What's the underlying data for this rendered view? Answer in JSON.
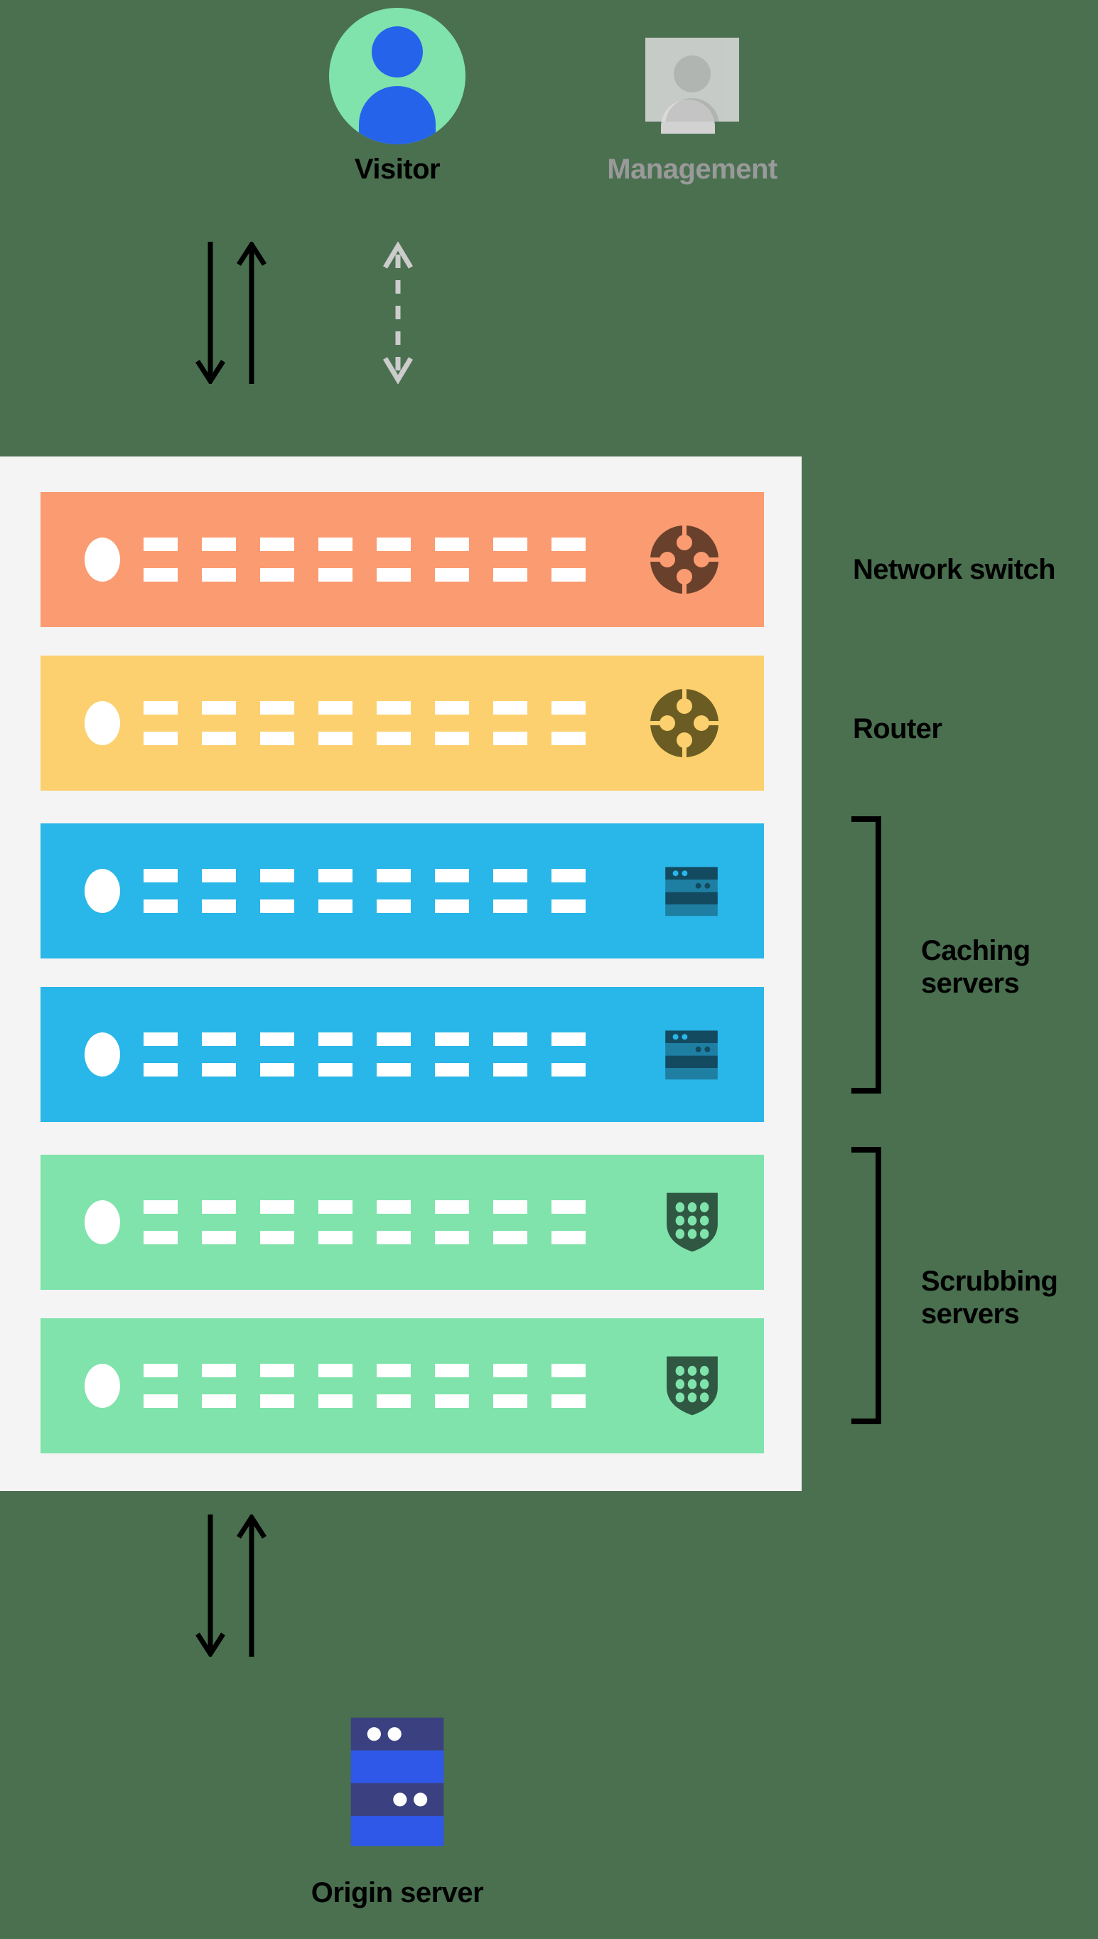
{
  "background_color": "#4a7050",
  "panel_color": "#f4f4f4",
  "actors": {
    "visitor": {
      "label": "Visitor",
      "icon": "person-avatar-icon",
      "label_color": "#000000",
      "circle_color": "#7fe3ab",
      "figure_color": "#2563eb"
    },
    "management": {
      "label": "Management",
      "icon": "management-person-icon",
      "label_color": "#9a9a9a",
      "panel_color": "#dcdcdc",
      "figure_color": "#c2c2c2"
    }
  },
  "connectors": {
    "visitor_top": {
      "name": "visitor-traffic-arrows",
      "style": "solid",
      "color": "#000000",
      "directions": [
        "down",
        "up"
      ]
    },
    "management_top": {
      "name": "management-arrow",
      "style": "dashed",
      "color": "#cccccc",
      "directions": [
        "up",
        "down"
      ]
    },
    "origin_bottom": {
      "name": "origin-traffic-arrows",
      "style": "solid",
      "color": "#000000",
      "directions": [
        "down",
        "up"
      ]
    }
  },
  "rack": {
    "rows": [
      {
        "id": "network-switch",
        "color": "#fb9b71",
        "icon": "network-hub-icon",
        "icon_color": "#68402c",
        "ports_per_row": 8,
        "port_rows": 2
      },
      {
        "id": "router",
        "color": "#fcd06e",
        "icon": "network-hub-icon",
        "icon_color": "#6b5c23",
        "ports_per_row": 8,
        "port_rows": 2
      },
      {
        "id": "caching-server-1",
        "color": "#29b6e8",
        "icon": "server-stack-icon",
        "icon_color": "#134a60",
        "icon_color_alt": "#1e7fa3",
        "ports_per_row": 8,
        "port_rows": 2
      },
      {
        "id": "caching-server-2",
        "color": "#29b6e8",
        "icon": "server-stack-icon",
        "icon_color": "#134a60",
        "icon_color_alt": "#1e7fa3",
        "ports_per_row": 8,
        "port_rows": 2
      },
      {
        "id": "scrubbing-server-1",
        "color": "#7fe3ab",
        "icon": "shield-dots-icon",
        "icon_color": "#2f5742",
        "ports_per_row": 8,
        "port_rows": 2
      },
      {
        "id": "scrubbing-server-2",
        "color": "#7fe3ab",
        "icon": "shield-dots-icon",
        "icon_color": "#2f5742",
        "ports_per_row": 8,
        "port_rows": 2
      }
    ]
  },
  "side_labels": [
    {
      "id": "network-switch-label",
      "text": "Network switch",
      "bracket": false
    },
    {
      "id": "router-label",
      "text": "Router",
      "bracket": false
    },
    {
      "id": "caching-servers-label",
      "line1": "Caching",
      "line2": "servers",
      "bracket": true
    },
    {
      "id": "scrubbing-servers-label",
      "line1": "Scrubbing",
      "line2": "servers",
      "bracket": true
    }
  ],
  "origin": {
    "label": "Origin server",
    "icon": "server-stack-icon",
    "band_dark": "#3b4080",
    "band_light": "#2f57e8",
    "dot_color": "#ffffff"
  }
}
